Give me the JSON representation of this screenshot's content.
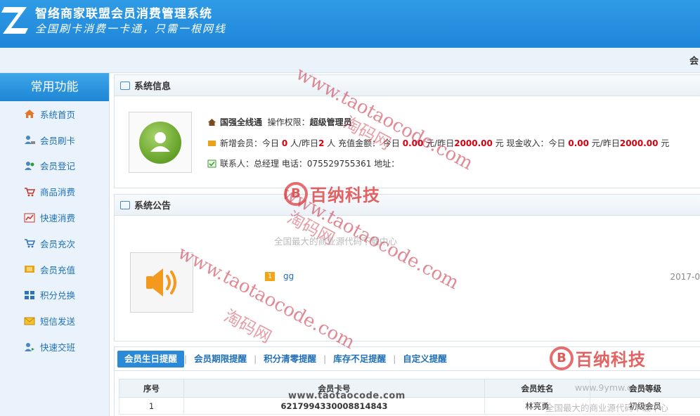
{
  "header": {
    "title": "智络商家联盟会员消费管理系统",
    "slogan": "全国刷卡消费一卡通，只需一根网线"
  },
  "subbar": {
    "text": "会"
  },
  "sidebar": {
    "title": "常用功能",
    "items": [
      {
        "label": "系统首页",
        "icon": "home-icon"
      },
      {
        "label": "会员刷卡",
        "icon": "user-card-icon"
      },
      {
        "label": "会员登记",
        "icon": "user-add-icon"
      },
      {
        "label": "商品消费",
        "icon": "cart-icon"
      },
      {
        "label": "快速消费",
        "icon": "chart-icon"
      },
      {
        "label": "会员充次",
        "icon": "cart-refill-icon"
      },
      {
        "label": "会员充值",
        "icon": "money-icon"
      },
      {
        "label": "积分兑换",
        "icon": "exchange-icon"
      },
      {
        "label": "短信发送",
        "icon": "mail-icon"
      },
      {
        "label": "快速交班",
        "icon": "shift-icon"
      }
    ]
  },
  "sysinfo": {
    "title": "系统信息",
    "shop": "国强全线通",
    "perm_label": "操作权限：",
    "perm_value": "超级管理员",
    "new_member_label": "新增会员：今日",
    "today_new": "0",
    "unit_person_yest": "人/昨日",
    "yest_new": "2",
    "recharge_label": "人 充值金额： 今日",
    "today_recharge": "0.00",
    "yuan_yest": "元/昨日",
    "yest_recharge": "2000.00",
    "cash_label": "元 现金收入：今日",
    "today_cash": "0.00",
    "yuan_yest2": "元/昨日",
    "yest_cash": "2000.00",
    "yuan_tail": "元",
    "contact": "联系人：总经理  电话：075529755361  地址："
  },
  "notice": {
    "title": "系统公告",
    "badge": "1",
    "item_title": "gg",
    "item_date": "2017-0"
  },
  "reminder": {
    "tabs": [
      "会员生日提醒",
      "会员期限提醒",
      "积分清零提醒",
      "库存不足提醒",
      "自定义提醒"
    ],
    "columns": [
      "序号",
      "会员卡号",
      "会员姓名",
      "会员等级"
    ],
    "rows": [
      {
        "no": "1",
        "card": "6217994330008814843",
        "name": "林亮勇",
        "level": "初级会员"
      }
    ]
  },
  "watermarks": {
    "url": "www.taotaocode.com",
    "cn": "淘码网",
    "brand": "百纳科技",
    "brand_mark": "B",
    "tagline": "全国最大的商业源代码下载中心",
    "site": "www.9ymw.com",
    "bottom_url": "www.taotaocode.com"
  },
  "colors": {
    "header": "#1f86d8",
    "accent": "#2a8ad8",
    "red": "#d6000f"
  }
}
